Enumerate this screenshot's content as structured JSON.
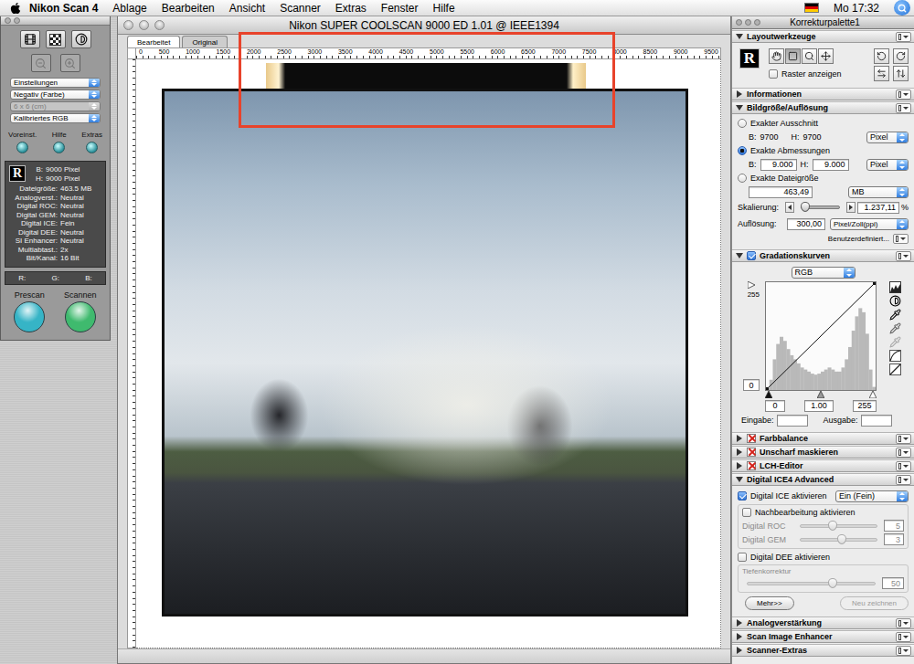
{
  "menubar": {
    "app": "Nikon Scan 4",
    "items": [
      "Ablage",
      "Bearbeiten",
      "Ansicht",
      "Scanner",
      "Extras",
      "Fenster",
      "Hilfe"
    ],
    "clock": "Mo 17:32"
  },
  "tool_palette": {
    "selects": [
      {
        "value": "Einstellungen",
        "disabled": false
      },
      {
        "value": "Negativ (Farbe)",
        "disabled": false
      },
      {
        "value": "6 x 6 (cm)",
        "disabled": true
      },
      {
        "value": "Kalibriertes RGB",
        "disabled": false
      }
    ],
    "knobs": [
      "Voreinst.",
      "Hilfe",
      "Extras"
    ],
    "badge": "R",
    "info": [
      {
        "label": "B:",
        "value": "9000 Pixel"
      },
      {
        "label": "H:",
        "value": "9000 Pixel"
      },
      {
        "label": "Dateigröße:",
        "value": "463.5 MB"
      },
      {
        "label": "Analogverst.:",
        "value": "Neutral"
      },
      {
        "label": "Digital ROC:",
        "value": "Neutral"
      },
      {
        "label": "Digital GEM:",
        "value": "Neutral"
      },
      {
        "label": "Digital ICE:",
        "value": "Fein"
      },
      {
        "label": "Digital DEE:",
        "value": "Neutral"
      },
      {
        "label": "SI Enhancer:",
        "value": "Neutral"
      },
      {
        "label": "Multiabtast.:",
        "value": "2x"
      },
      {
        "label": "Bit/Kanal:",
        "value": "16 Bit"
      }
    ],
    "rgb": [
      "R:",
      "G:",
      "B:"
    ],
    "scan": [
      {
        "label": "Prescan",
        "color": "#36b4c6"
      },
      {
        "label": "Scannen",
        "color": "#3fba6e"
      }
    ]
  },
  "window": {
    "title": "Nikon SUPER COOLSCAN 9000 ED 1.01 @ IEEE1394",
    "tabs": [
      {
        "label": "Bearbeitet",
        "selected": true
      },
      {
        "label": "Original",
        "selected": false
      }
    ],
    "ruler": [
      "0",
      "500",
      "1000",
      "1500",
      "2000",
      "2500",
      "3000",
      "3500",
      "4000",
      "4500",
      "5000",
      "5500",
      "6000",
      "6500",
      "7000",
      "7500",
      "8000",
      "8500",
      "9000",
      "9500"
    ]
  },
  "palette": {
    "title": "Korrekturpalette1",
    "sections": [
      {
        "kind": "layout",
        "title": "Layoutwerkzeuge",
        "expanded": true,
        "check": "none",
        "badge": "R",
        "tools": [
          {
            "kind": "hand",
            "selected": false
          },
          {
            "kind": "crop",
            "selected": true
          },
          {
            "kind": "zoom",
            "selected": false
          },
          {
            "kind": "move",
            "selected": false
          }
        ],
        "grid": {
          "label": "Raster anzeigen",
          "checked": false
        }
      },
      {
        "kind": "collapsed",
        "title": "Informationen",
        "expanded": false,
        "check": "none"
      },
      {
        "kind": "size",
        "title": "Bildgröße/Auflösung",
        "expanded": true,
        "check": "none",
        "modes": [
          {
            "label": "Exakter Ausschnitt",
            "selected": false,
            "kind": "readout",
            "fields": [
              {
                "label": "B:",
                "value": "9700"
              },
              {
                "label": "H:",
                "value": "9700"
              }
            ],
            "unit": "Pixel"
          },
          {
            "label": "Exakte Abmessungen",
            "selected": true,
            "kind": "inputs",
            "fields": [
              {
                "label": "B:",
                "value": "9.000"
              },
              {
                "label": "H:",
                "value": "9.000"
              }
            ],
            "unit": "Pixel"
          },
          {
            "label": "Exakte Dateigröße",
            "selected": false,
            "kind": "file",
            "fields": [
              {
                "value": "463,49"
              }
            ],
            "unit": "MB"
          }
        ],
        "scaling": {
          "label": "Skalierung:",
          "level": 0.12,
          "value": "1.237,11",
          "unit": "%"
        },
        "resolution": {
          "label": "Auflösung:",
          "value": "300,00",
          "unit": "Pixel/Zoll(ppi)"
        },
        "custom": "Benutzerdefiniert..."
      },
      {
        "kind": "curves",
        "title": "Gradationskurven",
        "expanded": true,
        "check": "checked",
        "channel": "RGB",
        "top": "255",
        "bottom": "0",
        "histogram": [
          2,
          10,
          30,
          45,
          52,
          48,
          40,
          34,
          30,
          26,
          22,
          20,
          18,
          16,
          15,
          16,
          18,
          20,
          22,
          20,
          18,
          18,
          22,
          30,
          42,
          58,
          72,
          80,
          76,
          55,
          20,
          3
        ],
        "input_low": "0",
        "gamma": "1.00",
        "input_high": "255",
        "input_label": "Eingabe:",
        "output_label": "Ausgabe:"
      },
      {
        "kind": "collapsed",
        "title": "Farbbalance",
        "expanded": false,
        "check": "crossed"
      },
      {
        "kind": "collapsed",
        "title": "Unscharf maskieren",
        "expanded": false,
        "check": "crossed"
      },
      {
        "kind": "collapsed",
        "title": "LCH-Editor",
        "expanded": false,
        "check": "crossed"
      },
      {
        "kind": "ice",
        "title": "Digital ICE4 Advanced",
        "expanded": true,
        "check": "none",
        "ice": {
          "label": "Digital ICE aktivieren",
          "checked": true,
          "mode": "Ein (Fein)"
        },
        "post": {
          "label": "Nachbearbeitung aktivieren",
          "checked": false
        },
        "sliders": [
          {
            "label": "Digital ROC",
            "value": "5",
            "level": 0.42,
            "disabled": true
          },
          {
            "label": "Digital GEM",
            "value": "3",
            "level": 0.54,
            "disabled": true
          }
        ],
        "dee": {
          "label": "Digital DEE aktivieren",
          "checked": false
        },
        "depth": {
          "label": "Tiefenkorrektur",
          "value": "50",
          "level": 0.67,
          "disabled": true
        },
        "buttons": [
          {
            "label": "Mehr>>",
            "disabled": false
          },
          {
            "label": "Neu zeichnen",
            "disabled": true
          }
        ]
      },
      {
        "kind": "collapsed",
        "title": "Analogverstärkung",
        "expanded": false,
        "check": "none"
      },
      {
        "kind": "collapsed",
        "title": "Scan Image Enhancer",
        "expanded": false,
        "check": "none"
      },
      {
        "kind": "collapsed",
        "title": "Scanner-Extras",
        "expanded": false,
        "check": "none"
      }
    ]
  }
}
